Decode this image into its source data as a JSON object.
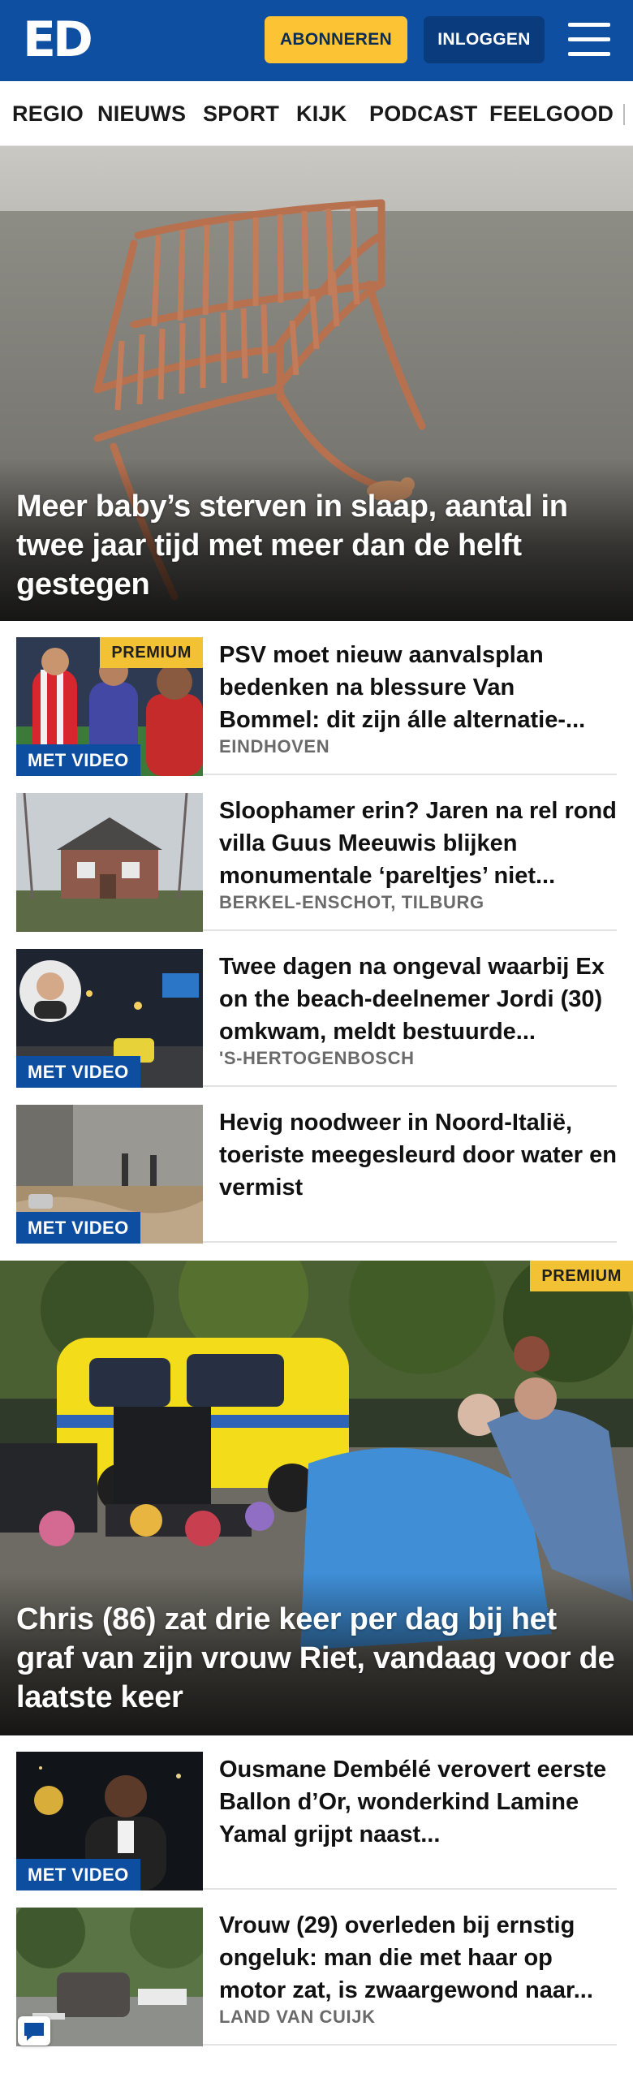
{
  "header": {
    "logo_text": "ED",
    "subscribe_label": "ABONNEREN",
    "login_label": "INLOGGEN",
    "menu_icon": "hamburger-menu-icon",
    "brand_color": "#0e4fa1",
    "subscribe_color": "#fcc434"
  },
  "nav": {
    "items": [
      "REGIO",
      "NIEUWS",
      "SPORT",
      "KIJK",
      "PODCAST",
      "FEELGOOD"
    ]
  },
  "hero1": {
    "title": "Meer baby’s sterven in slaap, aantal in twee jaar tijd met meer dan de helft gestegen"
  },
  "articles1": [
    {
      "title": "PSV moet nieuw aanvalsplan bedenken na blessure Van Bommel: dit zijn álle alternatie-...",
      "location": "EINDHOVEN",
      "premium": "PREMIUM",
      "video": "MET VIDEO"
    },
    {
      "title": "Sloophamer erin? Jaren na rel rond villa Guus Meeuwis blijken monumentale ‘pareltjes’ niet...",
      "location": "BERKEL-ENSCHOT, TILBURG"
    },
    {
      "title": "Twee dagen na ongeval waarbij Ex on the beach-deelnemer Jordi (30) omkwam, meldt bestuurde...",
      "location": "'S-HERTOGENBOSCH",
      "video": "MET VIDEO"
    },
    {
      "title": "Hevig noodweer in Noord-Italië, toeriste meegesleurd door water en vermist",
      "video": "MET VIDEO"
    }
  ],
  "hero2": {
    "title": "Chris (86) zat drie keer per dag bij het graf van zijn vrouw Riet, vandaag voor de laatste keer",
    "premium": "PREMIUM"
  },
  "articles2": [
    {
      "title": "Ousmane Dembélé verovert eerste Ballon d’Or, wonderkind Lamine Yamal grijpt naast...",
      "video": "MET VIDEO"
    },
    {
      "title": "Vrouw (29) overleden bij ernstig ongeluk: man die met haar op motor zat, is zwaargewond naar...",
      "location": "LAND VAN CUIJK"
    }
  ]
}
